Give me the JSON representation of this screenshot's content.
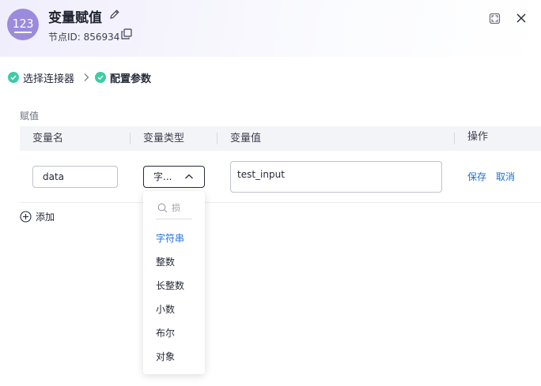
{
  "header": {
    "avatar_text": "123",
    "title": "变量赋值",
    "node_id_label": "节点ID: 856934"
  },
  "steps": [
    {
      "label": "选择连接器",
      "done": true
    },
    {
      "label": "配置参数",
      "done": true,
      "active": true
    }
  ],
  "section_label": "赋值",
  "table": {
    "columns": [
      "变量名",
      "变量类型",
      "变量值",
      "操作"
    ],
    "row": {
      "name": "data",
      "type": "字...",
      "value": "test_input",
      "actions": [
        "保存",
        "取消"
      ]
    }
  },
  "add_label": "添加",
  "dropdown": {
    "search_placeholder": "损",
    "options": [
      "字符串",
      "整数",
      "长整数",
      "小数",
      "布尔",
      "对象"
    ],
    "selected": "字符串"
  },
  "colors": {
    "accent": "#1e6fd9",
    "avatar": "#9b8bdc",
    "check": "#3dcca6"
  }
}
